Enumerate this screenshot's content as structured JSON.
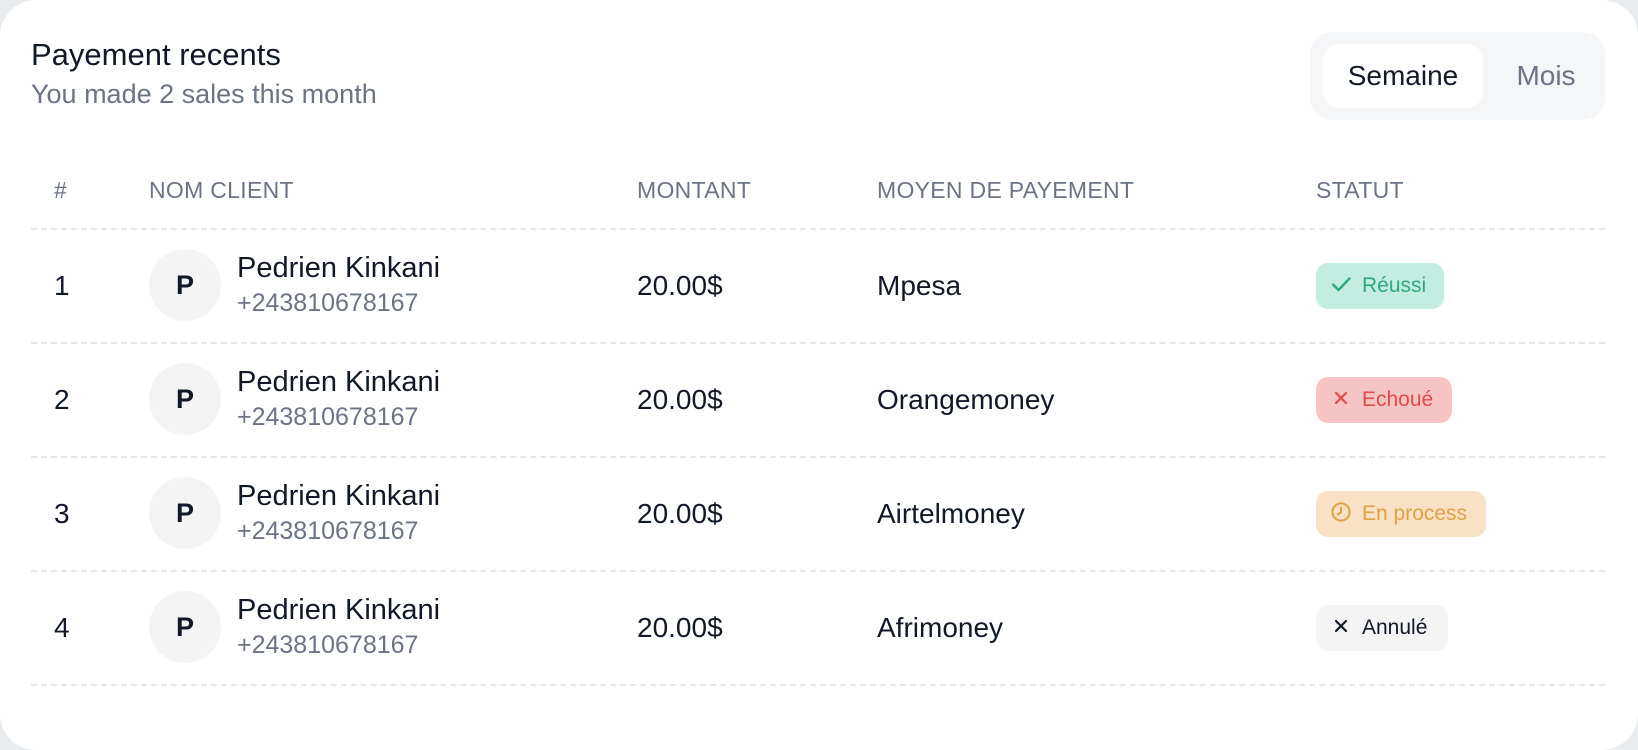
{
  "header": {
    "title": "Payement recents",
    "subtitle": "You made 2 sales this month"
  },
  "period_toggle": {
    "options": [
      "Semaine",
      "Mois"
    ],
    "selected": "Semaine"
  },
  "table": {
    "columns": [
      "#",
      "NOM CLIENT",
      "MONTANT",
      "MOYEN DE PAYEMENT",
      "STATUT"
    ],
    "rows": [
      {
        "index": "1",
        "avatar_initial": "P",
        "client_name": "Pedrien Kinkani",
        "client_phone": "+243810678167",
        "amount": "20.00$",
        "payment_method": "Mpesa",
        "status": "Réussi",
        "status_icon": "check-icon"
      },
      {
        "index": "2",
        "avatar_initial": "P",
        "client_name": "Pedrien Kinkani",
        "client_phone": "+243810678167",
        "amount": "20.00$",
        "payment_method": "Orangemoney",
        "status": "Echoué",
        "status_icon": "close-icon"
      },
      {
        "index": "3",
        "avatar_initial": "P",
        "client_name": "Pedrien Kinkani",
        "client_phone": "+243810678167",
        "amount": "20.00$",
        "payment_method": "Airtelmoney",
        "status": "En process",
        "status_icon": "clock-icon"
      },
      {
        "index": "4",
        "avatar_initial": "P",
        "client_name": "Pedrien Kinkani",
        "client_phone": "+243810678167",
        "amount": "20.00$",
        "payment_method": "Afrimoney",
        "status": "Annulé",
        "status_icon": "close-icon"
      }
    ]
  },
  "colors": {
    "success_bg": "#c2ede0",
    "success_fg": "#2fa880",
    "failed_bg": "#f7c4c4",
    "failed_fg": "#df4a4a",
    "process_bg": "#f8e1c4",
    "process_fg": "#e0a043",
    "cancel_bg": "#f4f4f5",
    "cancel_fg": "#111827"
  }
}
